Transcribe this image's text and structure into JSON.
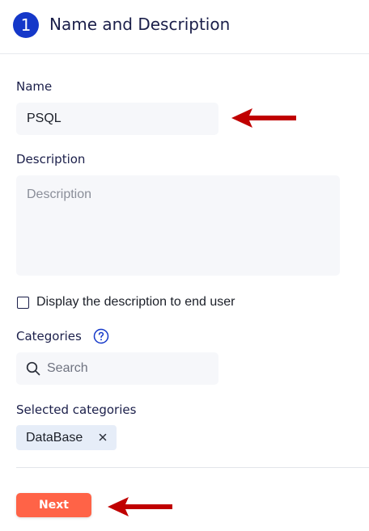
{
  "header": {
    "step_number": "1",
    "title": "Name and Description"
  },
  "form": {
    "name_label": "Name",
    "name_value": "PSQL",
    "description_label": "Description",
    "description_placeholder": "Description",
    "display_checkbox_label": "Display the description to end user",
    "display_checkbox_checked": false,
    "categories_label": "Categories",
    "categories_search_placeholder": "Search",
    "selected_categories_label": "Selected categories",
    "selected_categories": [
      "DataBase"
    ]
  },
  "actions": {
    "next_label": "Next"
  },
  "icons": {
    "search": "search-icon",
    "help": "help-circle-icon",
    "remove": "close-icon",
    "annotation": "arrow-left-icon"
  },
  "colors": {
    "accent_blue": "#1538c9",
    "next_button": "#ff6347",
    "annotation_arrow": "#c00000"
  }
}
